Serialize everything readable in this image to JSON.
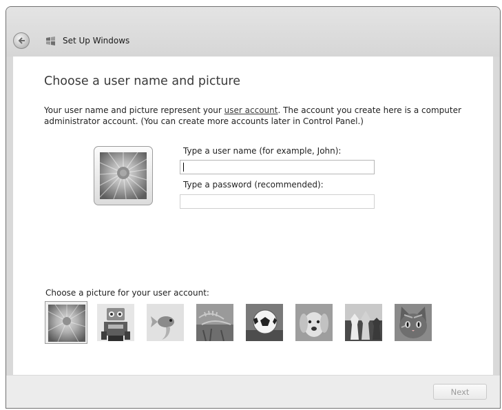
{
  "window": {
    "title": "Set Up Windows",
    "back_icon": "back-arrow-icon",
    "app_icon": "windows-setup-icon"
  },
  "main": {
    "heading": "Choose a user name and picture",
    "description_before_link": "Your user name and picture represent your ",
    "description_link": "user account",
    "description_after_link": ". The account you create here is a computer administrator account. (You can create more accounts later in Control Panel.)",
    "username_label": "Type a user name (for example, John):",
    "username_value": "",
    "password_label": "Type a password (recommended):",
    "password_value": ""
  },
  "picture_chooser": {
    "label": "Choose a picture for your user account:",
    "selected_index": 0,
    "pictures": [
      {
        "name": "flower-picture",
        "selected": true
      },
      {
        "name": "robot-picture",
        "selected": false
      },
      {
        "name": "goldfish-picture",
        "selected": false
      },
      {
        "name": "fern-picture",
        "selected": false
      },
      {
        "name": "soccer-ball-picture",
        "selected": false
      },
      {
        "name": "puppy-picture",
        "selected": false
      },
      {
        "name": "chess-picture",
        "selected": false
      },
      {
        "name": "kitten-picture",
        "selected": false
      }
    ]
  },
  "footer": {
    "next_label": "Next",
    "next_enabled": false
  }
}
